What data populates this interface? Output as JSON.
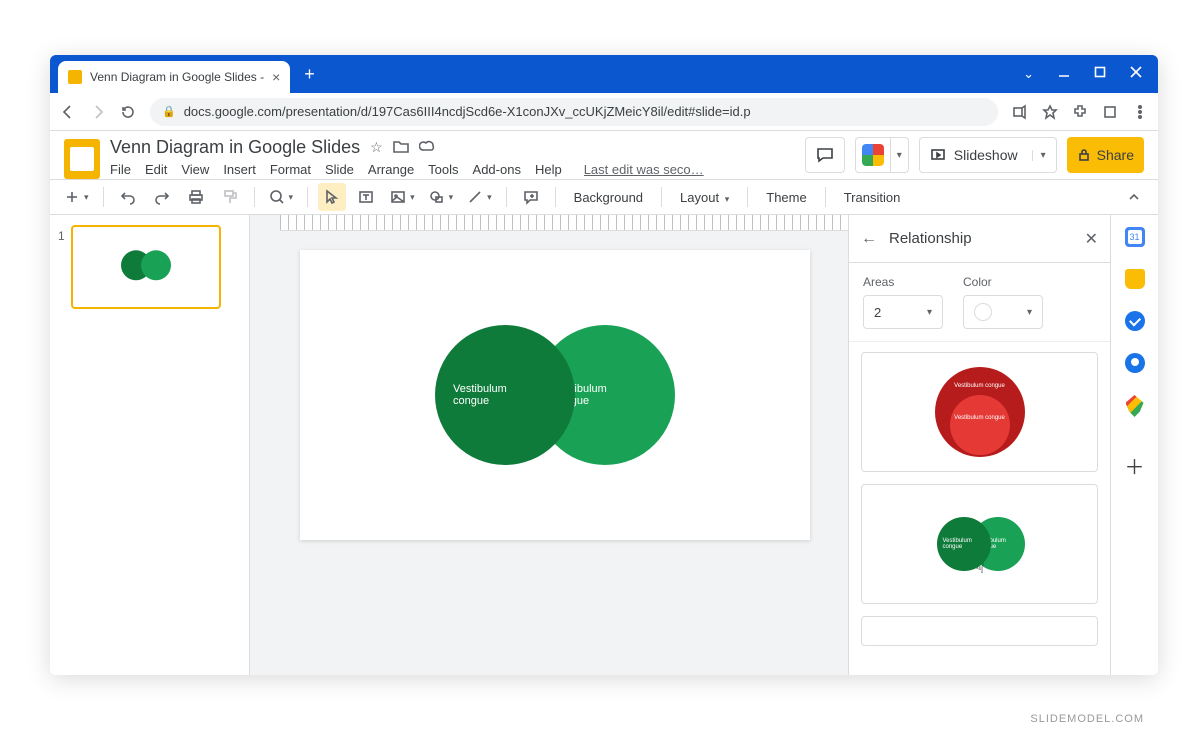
{
  "browser": {
    "tab_title": "Venn Diagram in Google Slides - ",
    "url": "docs.google.com/presentation/d/197Cas6III4ncdjScd6e-X1conJXv_ccUKjZMeicY8il/edit#slide=id.p"
  },
  "doc": {
    "title": "Venn Diagram in Google Slides",
    "menus": [
      "File",
      "Edit",
      "View",
      "Insert",
      "Format",
      "Slide",
      "Arrange",
      "Tools",
      "Add-ons",
      "Help"
    ],
    "last_edit": "Last edit was seco…"
  },
  "header_buttons": {
    "slideshow": "Slideshow",
    "share": "Share"
  },
  "toolbar": {
    "background": "Background",
    "layout": "Layout",
    "theme": "Theme",
    "transition": "Transition"
  },
  "slide": {
    "number": "1",
    "circle_a": "Vestibulum congue",
    "circle_b": "Vestibulum congue"
  },
  "panel": {
    "title": "Relationship",
    "areas_label": "Areas",
    "areas_value": "2",
    "color_label": "Color",
    "option1_label_a": "Vestibulum congue",
    "option1_label_b": "Vestibulum congue",
    "option2_label_a": "Vestibulum congue",
    "option2_label_b": "Vestibulum congue"
  },
  "watermark": "SLIDEMODEL.COM"
}
